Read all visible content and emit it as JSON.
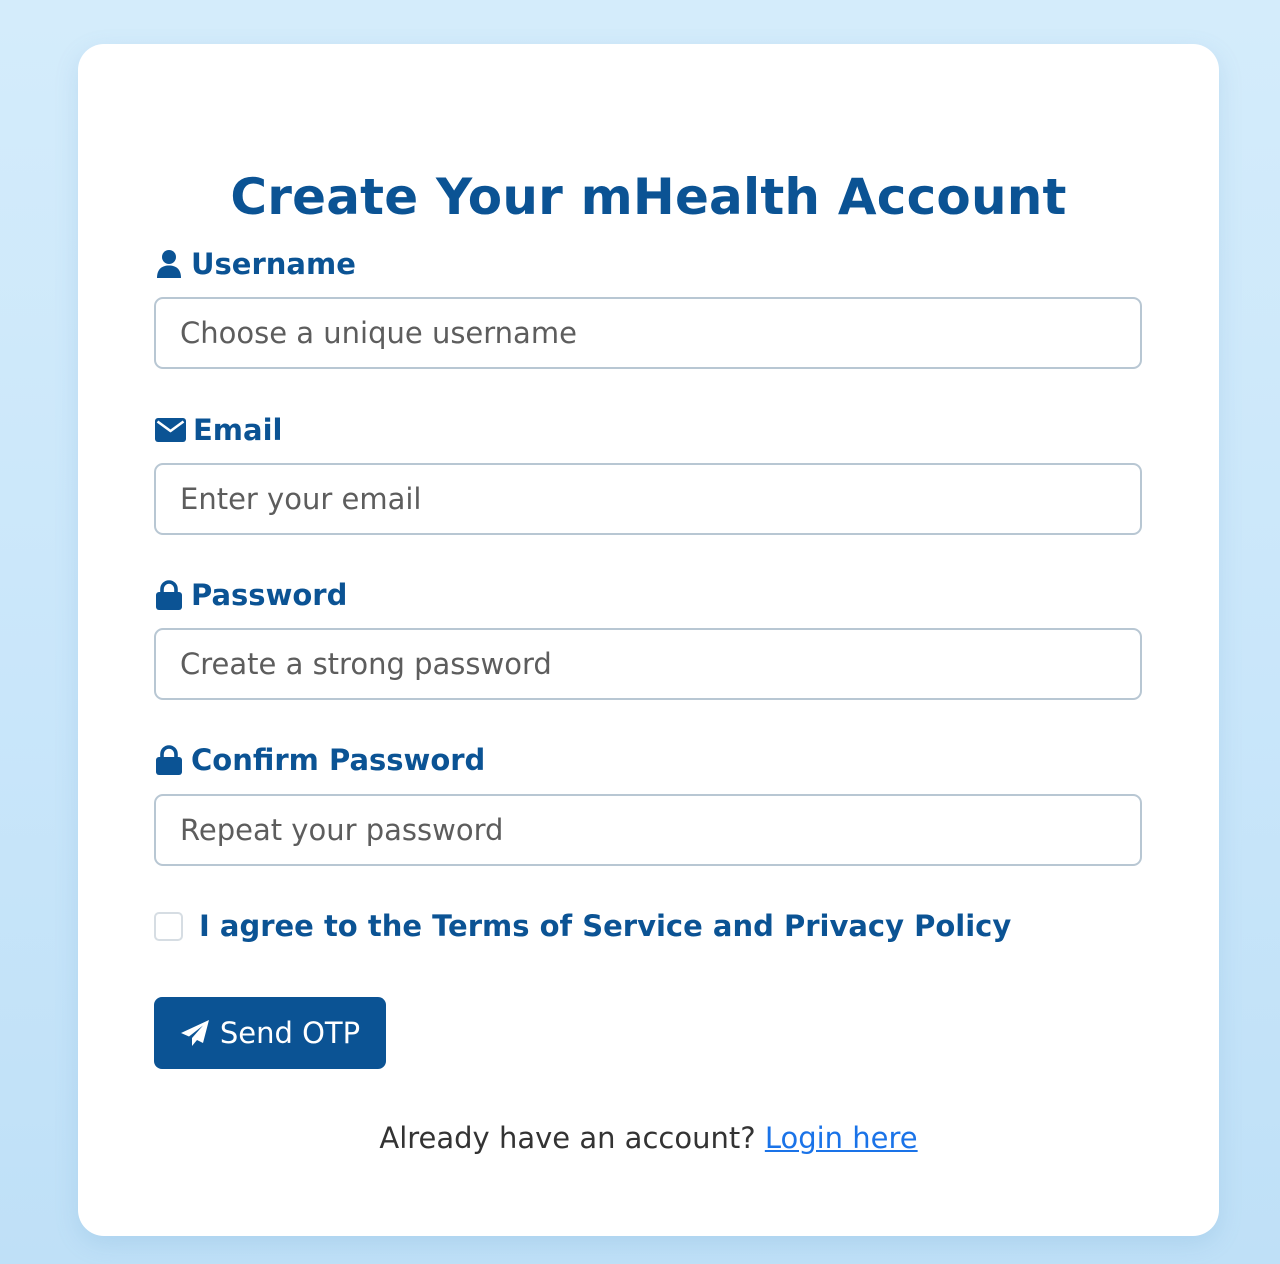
{
  "page": {
    "title": "Create Your mHealth Account"
  },
  "form": {
    "username": {
      "label": "Username",
      "icon": "user-icon",
      "placeholder": "Choose a unique username",
      "value": ""
    },
    "email": {
      "label": "Email",
      "icon": "envelope-icon",
      "placeholder": "Enter your email",
      "value": ""
    },
    "password": {
      "label": "Password",
      "icon": "lock-icon",
      "placeholder": "Create a strong password",
      "value": ""
    },
    "confirm_password": {
      "label": "Confirm Password",
      "icon": "lock-icon",
      "placeholder": "Repeat your password",
      "value": ""
    },
    "terms": {
      "label": "I agree to the Terms of Service and Privacy Policy",
      "checked": false
    },
    "submit": {
      "label": "Send OTP",
      "icon": "paper-plane-icon"
    }
  },
  "footer": {
    "prompt": "Already have an account?",
    "link_label": "Login here"
  },
  "colors": {
    "primary": "#0b5394",
    "link": "#1a73e8",
    "background": "#cfe9fb",
    "card": "#ffffff"
  }
}
